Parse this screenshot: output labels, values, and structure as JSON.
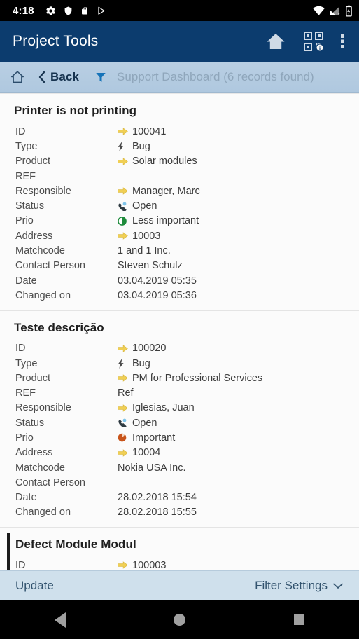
{
  "status_bar": {
    "time": "4:18",
    "left_icons": [
      "gear-icon",
      "shield-icon",
      "sd-card-icon",
      "play-store-icon"
    ],
    "right_icons": [
      "wifi-icon",
      "cellular-no-sim-icon",
      "battery-charging-icon"
    ]
  },
  "app_bar": {
    "title": "Project Tools",
    "actions": [
      "home-icon",
      "qr-scan-icon",
      "overflow-menu-icon"
    ]
  },
  "breadcrumb": {
    "home_icon": "home-outline-icon",
    "back_label": "Back",
    "filter_icon": "filter-funnel-icon",
    "title": "Support Dashboard (6 records found)"
  },
  "colors": {
    "appbar": "#0c3c6e",
    "breadcrumb": "#b4cce1",
    "bottombar": "#cfe0ec",
    "link_arrow": "#f0cf54",
    "prio_low": "#1e8b3c",
    "prio_high": "#c8541a",
    "selection_bar": "#1b1b1b"
  },
  "records": [
    {
      "title": "Printer is not printing",
      "selected": false,
      "rows": [
        {
          "label": "ID",
          "icon": "yellow-arrow-icon",
          "value": "100041"
        },
        {
          "label": "Type",
          "icon": "bolt-icon",
          "value": "Bug"
        },
        {
          "label": "Product",
          "icon": "yellow-arrow-icon",
          "value": "Solar modules"
        },
        {
          "label": "REF",
          "icon": "none",
          "value": ""
        },
        {
          "label": "Responsible",
          "icon": "yellow-arrow-icon",
          "value": "Manager, Marc"
        },
        {
          "label": "Status",
          "icon": "status-open-icon",
          "value": "Open"
        },
        {
          "label": "Prio",
          "icon": "prio-low-icon",
          "value": "Less important"
        },
        {
          "label": "Address",
          "icon": "yellow-arrow-icon",
          "value": "10003"
        },
        {
          "label": "Matchcode",
          "icon": "none",
          "value": "1 and 1 Inc."
        },
        {
          "label": "Contact Person",
          "icon": "none",
          "value": "Steven Schulz"
        },
        {
          "label": "Date",
          "icon": "none",
          "value": "03.04.2019 05:35"
        },
        {
          "label": "Changed on",
          "icon": "none",
          "value": "03.04.2019 05:36"
        }
      ]
    },
    {
      "title": "Teste descrição",
      "selected": false,
      "rows": [
        {
          "label": "ID",
          "icon": "yellow-arrow-icon",
          "value": "100020"
        },
        {
          "label": "Type",
          "icon": "bolt-icon",
          "value": "Bug"
        },
        {
          "label": "Product",
          "icon": "yellow-arrow-icon",
          "value": "PM for Professional Services"
        },
        {
          "label": "REF",
          "icon": "none",
          "value": "Ref"
        },
        {
          "label": "Responsible",
          "icon": "yellow-arrow-icon",
          "value": "Iglesias, Juan"
        },
        {
          "label": "Status",
          "icon": "status-open-icon",
          "value": "Open"
        },
        {
          "label": "Prio",
          "icon": "prio-high-icon",
          "value": "Important"
        },
        {
          "label": "Address",
          "icon": "yellow-arrow-icon",
          "value": "10004"
        },
        {
          "label": "Matchcode",
          "icon": "none",
          "value": "Nokia USA Inc."
        },
        {
          "label": "Contact Person",
          "icon": "none",
          "value": ""
        },
        {
          "label": "Date",
          "icon": "none",
          "value": "28.02.2018 15:54"
        },
        {
          "label": "Changed on",
          "icon": "none",
          "value": "28.02.2018 15:55"
        }
      ]
    },
    {
      "title": "Defect Module Modul",
      "selected": true,
      "rows": [
        {
          "label": "ID",
          "icon": "yellow-arrow-icon",
          "value": "100003"
        }
      ]
    }
  ],
  "bottom_bar": {
    "update_label": "Update",
    "filter_settings_label": "Filter Settings",
    "filter_settings_icon": "chevron-down-icon"
  },
  "nav_bar": {
    "back_icon": "nav-back-triangle-icon",
    "home_icon": "nav-home-circle-icon",
    "recents_icon": "nav-recents-square-icon"
  }
}
